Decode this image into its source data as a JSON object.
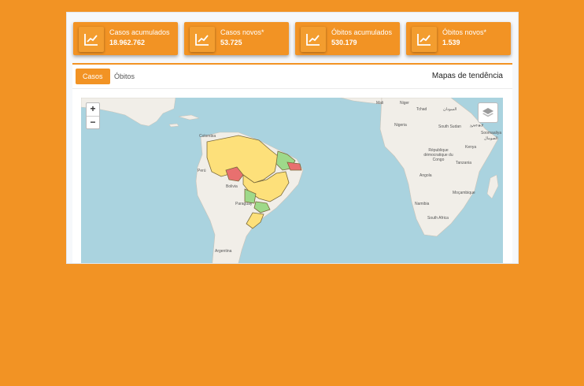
{
  "cards": [
    {
      "label": "Casos acumulados",
      "value": "18.962.762",
      "icon": "chart-line-icon"
    },
    {
      "label": "Casos novos*",
      "value": "53.725",
      "icon": "chart-line-icon"
    },
    {
      "label": "Óbitos acumulados",
      "value": "530.179",
      "icon": "chart-line-icon"
    },
    {
      "label": "Óbitos novos*",
      "value": "1.539",
      "icon": "chart-line-icon"
    }
  ],
  "tabs": {
    "casos": "Casos",
    "obitos": "Óbitos"
  },
  "section_title": "Mapas de tendência",
  "map": {
    "zoom_in": "+",
    "zoom_out": "−",
    "layers_icon": "layers-icon",
    "labels": {
      "mali": "Mali",
      "niger": "Niger",
      "tchad": "Tchad",
      "sudan_ar": "السودان",
      "nigeria": "Nigeria",
      "south_sudan": "South Sudan",
      "ethiopia_ar": "ኢትዮጵያ",
      "somalia": "Soomaaliya",
      "somalia_ar": "الصومال",
      "kenya": "Kenya",
      "drc": "République démocratique du Congo",
      "tanzania": "Tanzania",
      "angola": "Angola",
      "mozambique": "Moçambique",
      "namibia": "Namibia",
      "south_africa": "South Africa",
      "colombia": "Colombia",
      "peru": "Perú",
      "bolivia": "Bolivia",
      "paraguay": "Paraguay",
      "argentina": "Argentina"
    }
  },
  "colors": {
    "accent": "#f29324",
    "yellow": "#fde07a",
    "green": "#9ed98a",
    "red": "#e8706f",
    "ocean": "#aad3df",
    "land": "#f1eee8"
  }
}
